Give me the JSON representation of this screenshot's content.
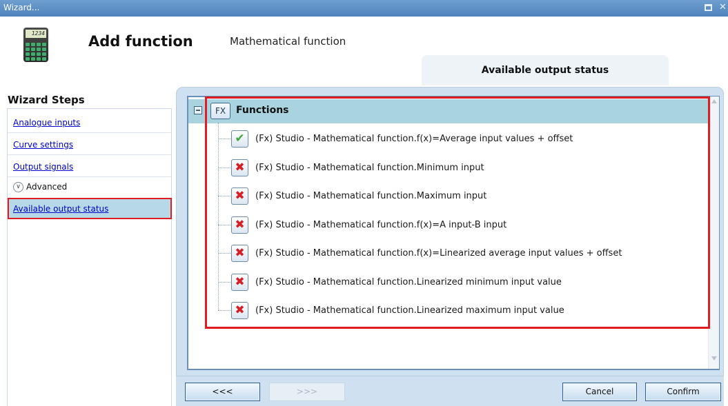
{
  "window": {
    "title": "Wizard..."
  },
  "header": {
    "calculator_display": "1234",
    "title": "Add function",
    "subtitle": "Mathematical function",
    "step_tab": "Available output status"
  },
  "sidebar": {
    "title": "Wizard Steps",
    "links": [
      "Analogue inputs",
      "Curve settings",
      "Output signals"
    ],
    "group": "Advanced",
    "active": "Available output status"
  },
  "tree": {
    "root_icon_label": "FX",
    "root_label": "Functions",
    "items": [
      {
        "label": "(Fx) Studio - Mathematical function.f(x)=Average input values + offset",
        "status": "check"
      },
      {
        "label": "(Fx) Studio - Mathematical function.Minimum input",
        "status": "cross"
      },
      {
        "label": "(Fx) Studio - Mathematical function.Maximum input",
        "status": "cross"
      },
      {
        "label": "(Fx) Studio - Mathematical function.f(x)=A input-B input",
        "status": "cross"
      },
      {
        "label": "(Fx) Studio - Mathematical function.f(x)=Linearized average  input values  + offset",
        "status": "cross"
      },
      {
        "label": "(Fx) Studio - Mathematical function.Linearized minimum input value",
        "status": "cross"
      },
      {
        "label": "(Fx) Studio - Mathematical function.Linearized maximum input value",
        "status": "cross"
      }
    ]
  },
  "footer": {
    "back": "<<<",
    "next": ">>>",
    "cancel": "Cancel",
    "confirm": "Confirm"
  },
  "icons": {
    "check": "✔",
    "cross": "✖",
    "chevron": "⌄"
  },
  "colors": {
    "highlight": "#e11b22",
    "selection": "#b7d8e6",
    "tree_header": "#a9d3de"
  }
}
